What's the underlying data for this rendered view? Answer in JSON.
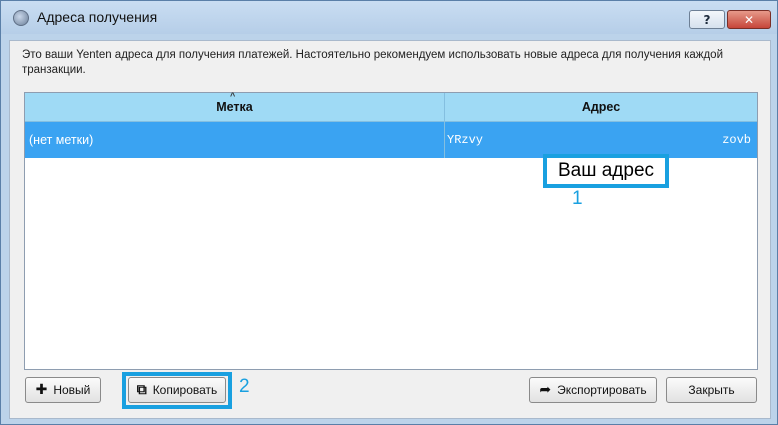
{
  "window": {
    "title": "Адреса получения",
    "help_glyph": "?",
    "close_glyph": "✕"
  },
  "description": "Это ваши Yenten адреса для получения платежей. Настоятельно рекомендуем использовать новые адреса для получения каждой транзакции.",
  "table": {
    "columns": [
      "Метка",
      "Адрес"
    ],
    "rows": [
      {
        "label": "(нет метки)",
        "address_start": "YRzvy",
        "address_end": "zovb",
        "selected": true
      }
    ]
  },
  "annotations": {
    "address_callout": "Ваш адрес",
    "marker_1": "1",
    "marker_2": "2",
    "accent_color": "#19a0e0"
  },
  "buttons": {
    "new": "Новый",
    "copy": "Копировать",
    "export": "Экспортировать",
    "close": "Закрыть"
  },
  "icons": {
    "new": "plus-icon",
    "copy": "copy-icon",
    "export": "share-arrow-icon"
  },
  "colors": {
    "header_bg": "#9fdaf5",
    "selected_row_bg": "#3aa3f2"
  }
}
